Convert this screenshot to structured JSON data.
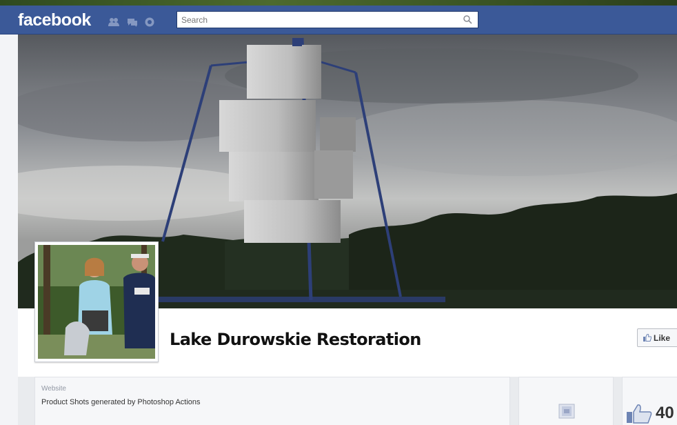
{
  "topbar": {
    "logo": "facebook",
    "search_placeholder": "Search",
    "icons": [
      "friend-requests-icon",
      "messages-icon",
      "notifications-icon",
      "search-icon"
    ]
  },
  "page": {
    "name": "Lake Durowskie Restoration",
    "like_button_label": "Like",
    "info": {
      "label": "Website",
      "text": "Product Shots generated by Photoshop Actions"
    },
    "likes_count": "40"
  },
  "colors": {
    "brand": "#3b5998",
    "background": "#e9ebee"
  }
}
